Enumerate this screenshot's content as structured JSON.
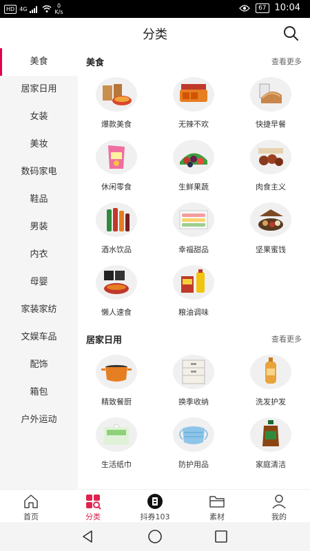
{
  "statusbar": {
    "hd": "HD",
    "signal": "4G",
    "net_speed_value": "0",
    "net_speed_unit": "K/s",
    "battery": "67",
    "time": "10:04"
  },
  "header": {
    "title": "分类"
  },
  "sidebar": {
    "items": [
      {
        "label": "美食"
      },
      {
        "label": "居家日用"
      },
      {
        "label": "女装"
      },
      {
        "label": "美妆"
      },
      {
        "label": "数码家电"
      },
      {
        "label": "鞋品"
      },
      {
        "label": "男装"
      },
      {
        "label": "内衣"
      },
      {
        "label": "母婴"
      },
      {
        "label": "家装家纺"
      },
      {
        "label": "文娱车品"
      },
      {
        "label": "配饰"
      },
      {
        "label": "箱包"
      },
      {
        "label": "户外运动"
      }
    ],
    "active_index": 0
  },
  "sections": [
    {
      "title": "美食",
      "more": "查看更多",
      "items": [
        {
          "label": "爆款美食",
          "icon": "food-bowl"
        },
        {
          "label": "无辣不欢",
          "icon": "spicy-snack"
        },
        {
          "label": "快捷早餐",
          "icon": "bread"
        },
        {
          "label": "休闲零食",
          "icon": "snack-bag"
        },
        {
          "label": "生鲜果蔬",
          "icon": "fruit"
        },
        {
          "label": "肉食主义",
          "icon": "meat"
        },
        {
          "label": "酒水饮品",
          "icon": "bottles"
        },
        {
          "label": "幸福甜品",
          "icon": "macarons"
        },
        {
          "label": "坚果蜜饯",
          "icon": "nuts"
        },
        {
          "label": "懒人速食",
          "icon": "noodles"
        },
        {
          "label": "粮油调味",
          "icon": "oil-rice"
        }
      ]
    },
    {
      "title": "居家日用",
      "more": "查看更多",
      "items": [
        {
          "label": "精致餐厨",
          "icon": "pot"
        },
        {
          "label": "换季收纳",
          "icon": "storage-box"
        },
        {
          "label": "洗发护发",
          "icon": "shampoo"
        },
        {
          "label": "生活纸巾",
          "icon": "tissue"
        },
        {
          "label": "防护用品",
          "icon": "mask"
        },
        {
          "label": "家庭清洁",
          "icon": "disinfectant"
        }
      ]
    }
  ],
  "bottom_nav": {
    "items": [
      {
        "label": "首页",
        "icon": "home-icon"
      },
      {
        "label": "分类",
        "icon": "category-icon"
      },
      {
        "label": "抖券103",
        "icon": "coupon-icon"
      },
      {
        "label": "素材",
        "icon": "folder-icon"
      },
      {
        "label": "我的",
        "icon": "user-icon"
      }
    ],
    "active_index": 1
  },
  "colors": {
    "accent": "#e0234e",
    "sidebar_bg": "#f5f5f5"
  }
}
